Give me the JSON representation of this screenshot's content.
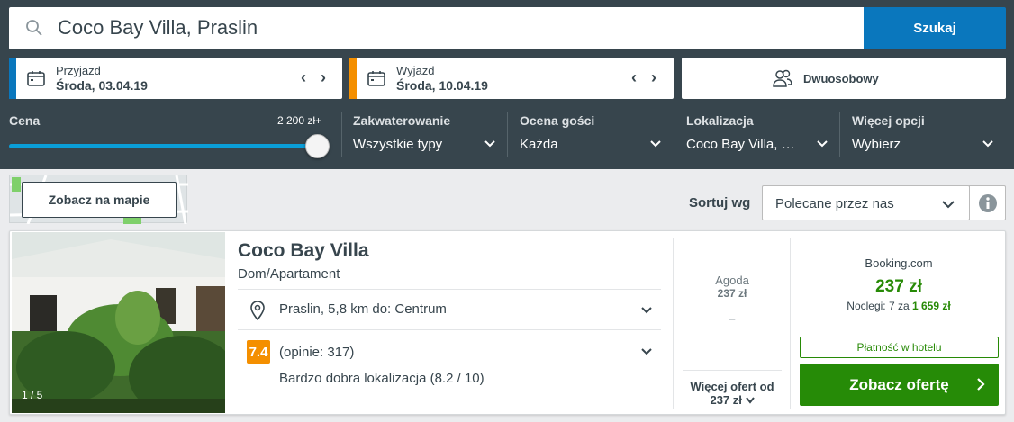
{
  "search": {
    "query": "Coco Bay Villa, Praslin",
    "button": "Szukaj"
  },
  "checkin": {
    "label": "Przyjazd",
    "value": "Środa, 03.04.19",
    "accent": "#0a77bd"
  },
  "checkout": {
    "label": "Wyjazd",
    "value": "Środa, 10.04.19",
    "accent": "#f48f00"
  },
  "room": {
    "label": "Dwuosobowy"
  },
  "filters": {
    "price": {
      "label": "Cena",
      "max": "2 200 zł+",
      "slider_fraction": 1.0
    },
    "accommodation": {
      "label": "Zakwaterowanie",
      "value": "Wszystkie typy"
    },
    "rating": {
      "label": "Ocena gości",
      "value": "Każda"
    },
    "location": {
      "label": "Lokalizacja",
      "value": "Coco Bay Villa, …"
    },
    "more": {
      "label": "Więcej opcji",
      "value": "Wybierz"
    }
  },
  "map": {
    "button": "Zobacz na mapie"
  },
  "sort": {
    "label": "Sortuj wg",
    "value": "Polecane przez nas"
  },
  "hotel": {
    "name": "Coco Bay Villa",
    "type": "Dom/Apartament",
    "photo_counter": "1 / 5",
    "location": "Praslin, 5,8 km do: Centrum",
    "rating": "7.4",
    "reviews": "(opinie: 317)",
    "rating_desc": "Bardzo dobra lokalizacja (8.2 / 10)"
  },
  "alt_offer": {
    "provider": "Agoda",
    "price": "237 zł",
    "dash": "–",
    "more": "Więcej ofert od",
    "more_price": "237 zł"
  },
  "main_offer": {
    "provider": "Booking.com",
    "price": "237 zł",
    "nights_prefix": "Noclegi: 7 za",
    "nights_total": "1 659 zł",
    "payment": "Płatność w hotelu",
    "button": "Zobacz ofertę",
    "color": "#268b07"
  }
}
